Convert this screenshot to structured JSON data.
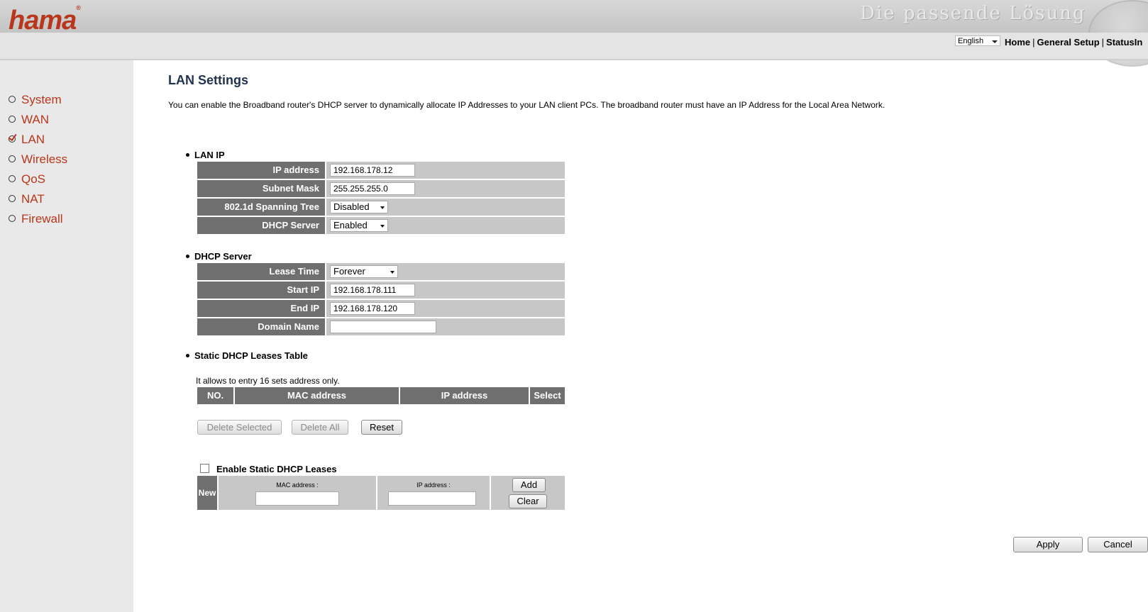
{
  "header": {
    "logo": "hama",
    "logo_mark": "®",
    "slogan": "Die passende Lösung"
  },
  "topbar": {
    "language": "English",
    "links": [
      "Home",
      "General Setup",
      "StatusIn"
    ],
    "separator": "|"
  },
  "sidebar": {
    "items": [
      {
        "label": "System",
        "active": false
      },
      {
        "label": "WAN",
        "active": false
      },
      {
        "label": "LAN",
        "active": true
      },
      {
        "label": "Wireless",
        "active": false
      },
      {
        "label": "QoS",
        "active": false
      },
      {
        "label": "NAT",
        "active": false
      },
      {
        "label": "Firewall",
        "active": false
      }
    ]
  },
  "page": {
    "title": "LAN Settings",
    "description": "You can enable the Broadband router's DHCP server to dynamically allocate IP Addresses to your LAN client PCs. The broadband router must have an IP Address for the Local Area Network."
  },
  "lan_ip": {
    "section_title": "LAN IP",
    "ip_label": "IP address",
    "ip_value": "192.168.178.12",
    "mask_label": "Subnet Mask",
    "mask_value": "255.255.255.0",
    "stp_label": "802.1d Spanning Tree",
    "stp_value": "Disabled",
    "dhcp_label": "DHCP Server",
    "dhcp_value": "Enabled"
  },
  "dhcp_server": {
    "section_title": "DHCP Server",
    "lease_label": "Lease Time",
    "lease_value": "Forever",
    "start_label": "Start IP",
    "start_value": "192.168.178.111",
    "end_label": "End IP",
    "end_value": "192.168.178.120",
    "domain_label": "Domain Name",
    "domain_value": ""
  },
  "static_table": {
    "section_title": "Static DHCP Leases Table",
    "note": "It allows to entry 16 sets address only.",
    "columns": [
      "NO.",
      "MAC address",
      "IP address",
      "Select"
    ],
    "delete_selected": "Delete Selected",
    "delete_all": "Delete All",
    "reset": "Reset"
  },
  "static_entry": {
    "enable_label": "Enable Static DHCP Leases",
    "enabled": false,
    "new_label": "New",
    "mac_label": "MAC address :",
    "ip_label": "IP address :",
    "add": "Add",
    "clear": "Clear"
  },
  "footer": {
    "apply": "Apply",
    "cancel": "Cancel"
  },
  "colors": {
    "brand": "#b8361b",
    "title": "#1f3350",
    "label_bg": "#6f6f6f",
    "value_bg": "#c7c7c7"
  }
}
